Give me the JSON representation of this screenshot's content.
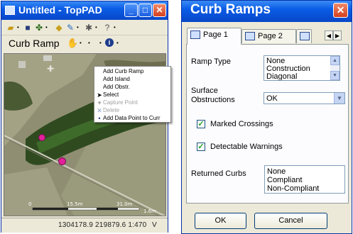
{
  "left_window": {
    "title": "Untitled - TopPAD",
    "toolbar2_label": "Curb Ramp",
    "context_menu": [
      {
        "label": "Add Curb Ramp",
        "icon": "none",
        "enabled": true
      },
      {
        "label": "Add Island",
        "icon": "none",
        "enabled": true
      },
      {
        "label": "Add Obstr.",
        "icon": "none",
        "enabled": true
      },
      {
        "label": "Select",
        "icon": "arrow-cursor-icon",
        "enabled": true
      },
      {
        "label": "Capture Point",
        "icon": "capture-icon",
        "enabled": false
      },
      {
        "label": "Delete",
        "icon": "delete-x-icon",
        "enabled": false
      },
      {
        "label": "Add Data Point to Curr",
        "icon": "dot-icon",
        "enabled": true
      }
    ],
    "scale_labels": [
      "0",
      "15.5m",
      "31.0m",
      "1.6m"
    ],
    "status_text": "1304178.9 219879.6  1:470",
    "status_v": "V"
  },
  "right_window": {
    "title": "Curb Ramps",
    "tabs": [
      "Page 1",
      "Page 2"
    ],
    "ramp_type_label": "Ramp Type",
    "ramp_type_options": [
      "None",
      "Construction",
      "Diagonal"
    ],
    "surface_label_line1": "Surface",
    "surface_label_line2": "Obstructions",
    "surface_value": "OK",
    "marked_crossings_label": "Marked Crossings",
    "marked_crossings_checked": true,
    "detectable_warnings_label": "Detectable Warnings",
    "detectable_warnings_checked": true,
    "returned_curbs_label": "Returned Curbs",
    "returned_curbs_options": [
      "None",
      "Compliant",
      "Non-Compliant"
    ],
    "ok_label": "OK",
    "cancel_label": "Cancel"
  },
  "colors": {
    "titlebar": "#0a5ce6",
    "window_face": "#ece9d8",
    "close_button": "#d4401f",
    "map_marker": "#e3209a"
  }
}
